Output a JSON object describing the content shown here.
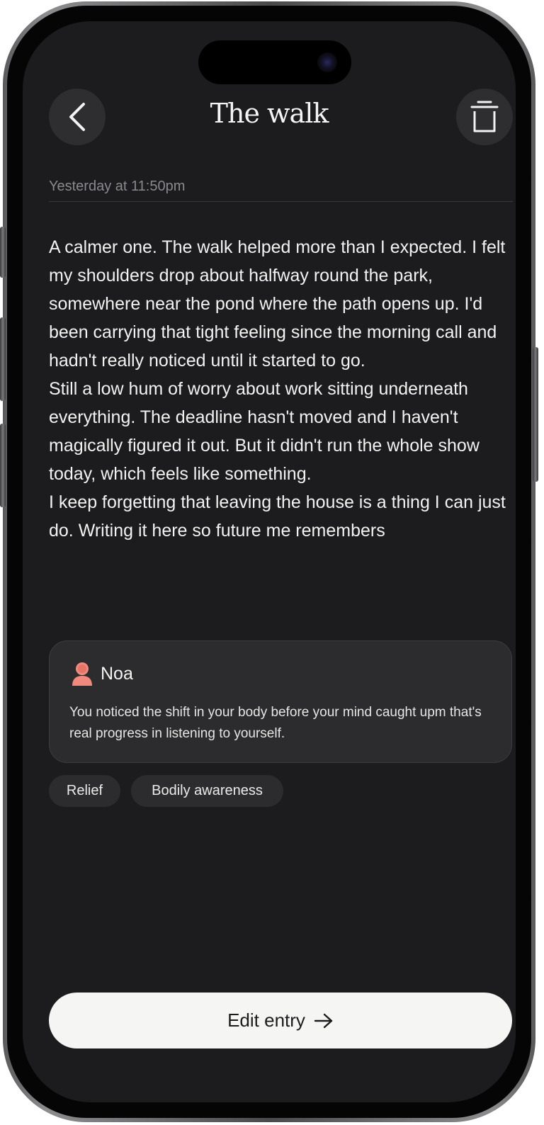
{
  "header": {
    "title": "The walk"
  },
  "entry": {
    "timestamp": "Yesterday at 11:50pm",
    "paragraphs": [
      "A calmer one. The walk helped more than I expected. I felt my shoulders drop about halfway round the park, somewhere near the pond where the path opens up. I'd been carrying that tight feeling since the morning call and hadn't really noticed until it started to go.",
      "Still a low hum of worry about work sitting underneath everything. The deadline hasn't moved and I haven't magically figured it out. But it didn't run the whole show today, which feels like something.",
      "I keep forgetting that leaving the house is a thing I can just do. Writing it here so future me remembers"
    ]
  },
  "companion": {
    "name": "Noa",
    "message": "You noticed the shift in your body before your mind caught upm that's real progress in listening to yourself."
  },
  "tags": [
    "Relief",
    "Bodily awareness"
  ],
  "footer": {
    "edit_label": "Edit entry"
  },
  "icons": {
    "back": "chevron-left-icon",
    "delete": "trash-icon",
    "companion_avatar": "avatar-icon",
    "cta": "arrow-right-icon"
  },
  "colors": {
    "background": "#1c1c1e",
    "card": "#2c2c2e",
    "avatar": "#f08a7e",
    "button": "#f5f5f4"
  }
}
